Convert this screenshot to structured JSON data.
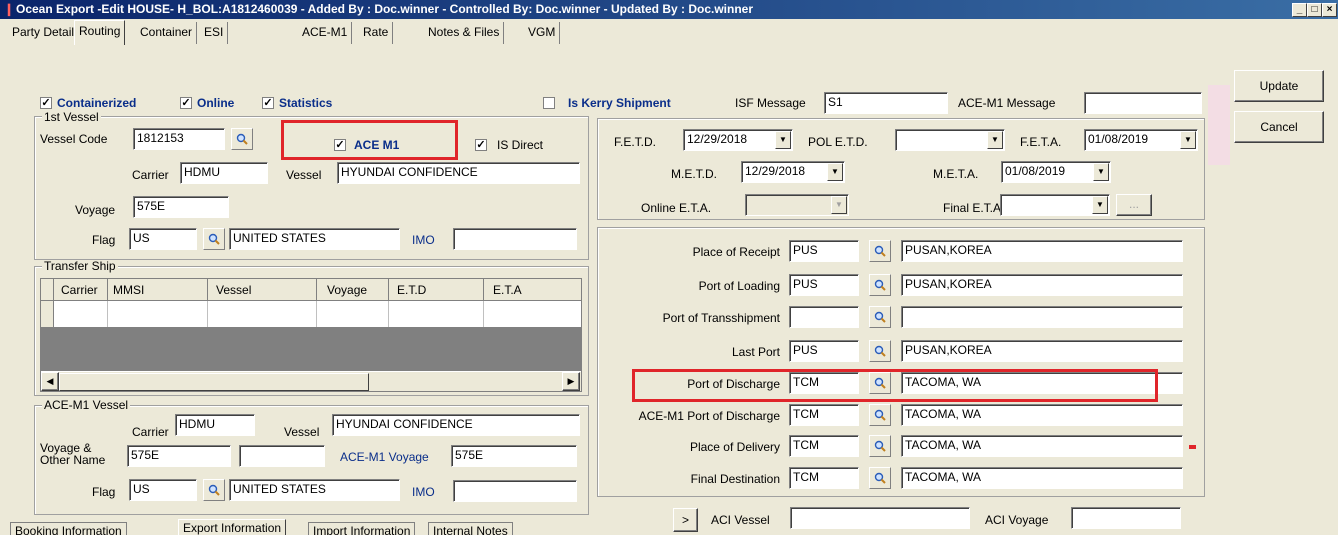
{
  "window": {
    "title": "Ocean Export -Edit HOUSE- H_BOL:A1812460039 - Added By : Doc.winner - Controlled By: Doc.winner - Updated By : Doc.winner",
    "min": "_",
    "max": "□",
    "close": "×"
  },
  "tabs": [
    "Party Detail",
    "Routing",
    "Container",
    "ESI",
    "ACE-M1",
    "Rate",
    "Notes & Files",
    "VGM"
  ],
  "buttons": {
    "update": "Update",
    "cancel": "Cancel",
    "aci_arrow": ">"
  },
  "flags": {
    "containerized": "Containerized",
    "online": "Online",
    "statistics": "Statistics",
    "is_kerry": "Is Kerry Shipment",
    "check": "✓"
  },
  "isf": {
    "label": "ISF Message",
    "value": "S1",
    "acem1_label": "ACE-M1 Message",
    "acem1_value": ""
  },
  "vessel1": {
    "group": "1st Vessel",
    "code_label": "Vessel Code",
    "code": "1812153",
    "ace_m1": "ACE M1",
    "is_direct": "IS Direct",
    "carrier_label": "Carrier",
    "carrier": "HDMU",
    "vessel_label": "Vessel",
    "vessel": "HYUNDAI CONFIDENCE",
    "voyage_label": "Voyage",
    "voyage": "575E",
    "flag_label": "Flag",
    "flag": "US",
    "country": "UNITED STATES",
    "imo_label": "IMO",
    "imo": ""
  },
  "transfer": {
    "group": "Transfer Ship",
    "columns": [
      "Carrier",
      "MMSI",
      "Vessel",
      "Voyage",
      "E.T.D",
      "E.T.A"
    ]
  },
  "acem1": {
    "group": "ACE-M1 Vessel",
    "carrier_label": "Carrier",
    "carrier": "HDMU",
    "vessel_label": "Vessel",
    "vessel": "HYUNDAI CONFIDENCE",
    "voyage_label_1": "Voyage &",
    "voyage_label_2": "Other Name",
    "voyage": "575E",
    "other": "",
    "acem1_voyage_label": "ACE-M1 Voyage",
    "acem1_voyage": "575E",
    "flag_label": "Flag",
    "flag": "US",
    "country": "UNITED STATES",
    "imo_label": "IMO",
    "imo": ""
  },
  "dates": {
    "fetd_label": "F.E.T.D.",
    "fetd": "12/29/2018",
    "poletd_label": "POL E.T.D.",
    "poletd": "",
    "feta_label": "F.E.T.A.",
    "feta": "01/08/2019",
    "metd_label": "M.E.T.D.",
    "metd": "12/29/2018",
    "meta_label": "M.E.T.A.",
    "meta": "01/08/2019",
    "online_eta_label": "Online E.T.A.",
    "online_eta": "",
    "final_eta_label": "Final E.T.A.",
    "final_eta": "",
    "ellipsis": "..."
  },
  "ports": [
    {
      "label": "Place of Receipt",
      "code": "PUS",
      "name": "PUSAN,KOREA"
    },
    {
      "label": "Port of Loading",
      "code": "PUS",
      "name": "PUSAN,KOREA"
    },
    {
      "label": "Port of Transshipment",
      "code": "",
      "name": ""
    },
    {
      "label": "Last Port",
      "code": "PUS",
      "name": "PUSAN,KOREA"
    },
    {
      "label": "Port of Discharge",
      "code": "TCM",
      "name": "TACOMA, WA"
    },
    {
      "label": "ACE-M1 Port of Discharge",
      "code": "TCM",
      "name": "TACOMA, WA"
    },
    {
      "label": "Place of Delivery",
      "code": "TCM",
      "name": "TACOMA, WA"
    },
    {
      "label": "Final Destination",
      "code": "TCM",
      "name": "TACOMA, WA"
    }
  ],
  "aci": {
    "vessel_label": "ACI Vessel",
    "vessel": "",
    "voyage_label": "ACI Voyage",
    "voyage": ""
  },
  "bottom_tabs": [
    "Booking Information",
    "Export Information",
    "Import Information",
    "Internal Notes"
  ],
  "colors": {
    "highlight": "#e0252a",
    "title_bar": "#0a246a"
  }
}
